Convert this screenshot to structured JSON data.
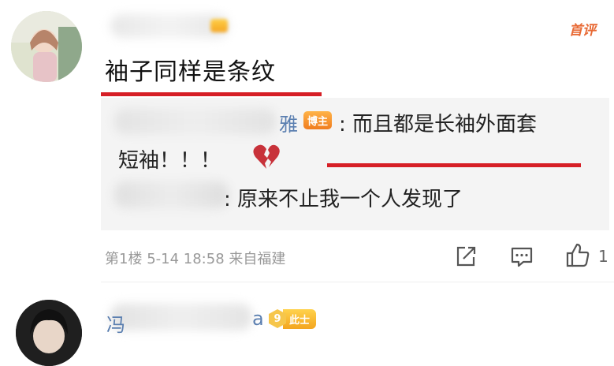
{
  "comment": {
    "text": "袖子同样是条纹",
    "badge": "首评"
  },
  "replies": [
    {
      "name_tail": "雅",
      "badge": "博主",
      "text": ": 而且都是长袖外面套",
      "text_cont": "短袖！！！"
    },
    {
      "text": ": 原来不止我一个人发现了"
    }
  ],
  "meta": {
    "floor": "第1楼",
    "date": "5-14",
    "time": "18:58",
    "location": "来自福建",
    "like_count": "1"
  },
  "next_comment": {
    "name_start": "冯",
    "name_end": "a",
    "level": "9",
    "level_label": "此士"
  },
  "icons": [
    "share-icon",
    "comment-icon",
    "like-icon",
    "broken-heart-icon"
  ],
  "colors": {
    "highlight_line": "#d61f26",
    "username": "#5b7fb0",
    "badge": "#f5a623"
  }
}
